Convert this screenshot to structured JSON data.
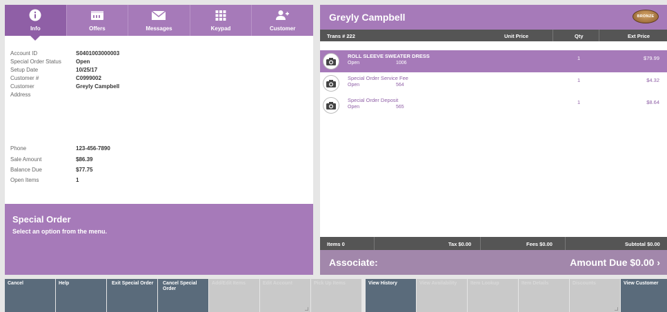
{
  "tabs": [
    {
      "label": "Info",
      "icon": "info-icon"
    },
    {
      "label": "Offers",
      "icon": "offers-icon"
    },
    {
      "label": "Messages",
      "icon": "envelope-icon"
    },
    {
      "label": "Keypad",
      "icon": "keypad-icon"
    },
    {
      "label": "Customer",
      "icon": "add-customer-icon"
    }
  ],
  "details": {
    "account_id_label": "Account ID",
    "account_id": "S0401003000003",
    "status_label": "Special Order Status",
    "status": "Open",
    "setup_date_label": "Setup Date",
    "setup_date": "10/25/17",
    "customer_num_label": "Customer #",
    "customer_num": "C0999002",
    "customer_label": "Customer",
    "customer": "Greyly Campbell",
    "address_label": "Address",
    "phone_label": "Phone",
    "phone": "123-456-7890",
    "sale_amount_label": "Sale Amount",
    "sale_amount": "$86.39",
    "balance_due_label": "Balance Due",
    "balance_due": "$77.75",
    "open_items_label": "Open Items",
    "open_items": "1"
  },
  "special_order": {
    "title": "Special Order",
    "subtitle": "Select an option from the menu."
  },
  "transaction": {
    "customer_name": "Greyly Campbell",
    "badge": "BRONZE",
    "columns": {
      "trans": "Trans # 222",
      "unit_price": "Unit Price",
      "qty": "Qty",
      "ext_price": "Ext Price"
    },
    "items": [
      {
        "name": "ROLL SLEEVE SWEATER DRESS",
        "status": "Open",
        "sku": "1006",
        "qty": "1",
        "price": "$79.99"
      },
      {
        "name": "Special Order Service Fee",
        "status": "Open",
        "sku": "564",
        "qty": "1",
        "price": "$4.32"
      },
      {
        "name": "Special Order Deposit",
        "status": "Open",
        "sku": "565",
        "qty": "1",
        "price": "$8.64"
      }
    ],
    "footer": {
      "items": "Items 0",
      "tax": "Tax $0.00",
      "fees": "Fees $0.00",
      "subtotal": "Subtotal $0.00"
    },
    "associate": "Associate:",
    "amount_due": "Amount Due  $0.00  ›"
  },
  "menu_buttons": [
    {
      "label": "Cancel",
      "enabled": true
    },
    {
      "label": "Help",
      "enabled": true
    },
    {
      "label": "Exit Special Order",
      "enabled": true
    },
    {
      "label": "Cancel Special Order",
      "enabled": true
    },
    {
      "label": "Add/Edit Items",
      "enabled": false
    },
    {
      "label": "Edit Account",
      "enabled": false
    },
    {
      "label": "Pick Up Items",
      "enabled": false
    },
    {
      "label": "View History",
      "enabled": true
    },
    {
      "label": "View Availability",
      "enabled": false
    },
    {
      "label": "Item Lookup",
      "enabled": false
    },
    {
      "label": "Item Details",
      "enabled": false
    },
    {
      "label": "Discounts",
      "enabled": false
    },
    {
      "label": "View Customer",
      "enabled": true
    }
  ],
  "colors": {
    "accent": "#a67ab9",
    "accent_dark": "#8f5fa6",
    "button": "#5a6b7b",
    "header_bar": "#555555"
  }
}
